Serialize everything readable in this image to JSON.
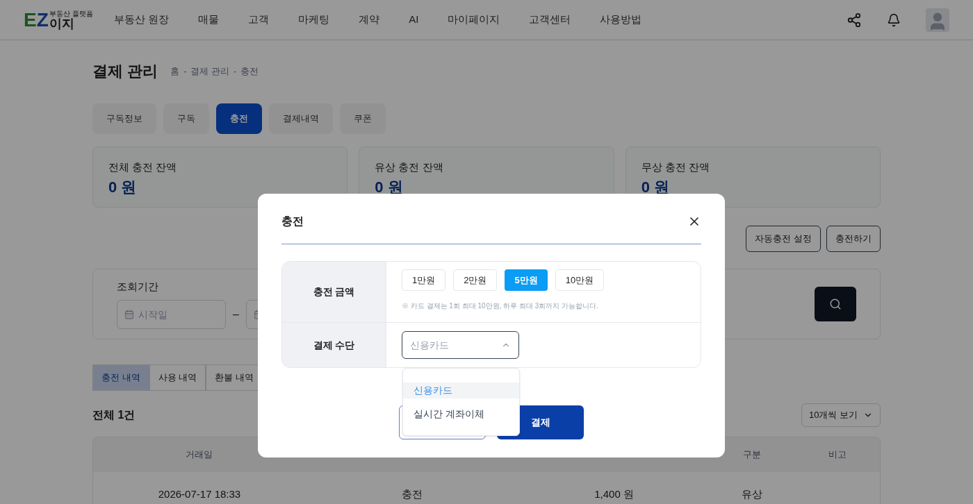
{
  "logo": {
    "mark_left": "E",
    "mark_right": "Z",
    "word": "이지",
    "tagline": "부동산 플랫폼"
  },
  "nav": [
    "부동산 원장",
    "매물",
    "고객",
    "마케팅",
    "계약",
    "AI",
    "마이페이지",
    "고객센터",
    "사용방법"
  ],
  "page": {
    "title": "결제 관리",
    "breadcrumb": [
      "홈",
      "결제 관리",
      "충전"
    ],
    "breadcrumb_separator": "-"
  },
  "tabs": [
    {
      "label": "구독정보",
      "selected": false
    },
    {
      "label": "구독",
      "selected": false
    },
    {
      "label": "충전",
      "selected": true
    },
    {
      "label": "결제내역",
      "selected": false
    },
    {
      "label": "쿠폰",
      "selected": false
    }
  ],
  "balances": [
    {
      "label": "전체 충전 잔액",
      "value": "0 원"
    },
    {
      "label": "유상 충전 잔액",
      "value": "0 원"
    },
    {
      "label": "무상 충전 잔액",
      "value": "0 원"
    }
  ],
  "actions": [
    "자동충전 설정",
    "충전하기"
  ],
  "filter": {
    "label": "조회기간",
    "start_placeholder": "시작일",
    "separator": "–"
  },
  "history_tabs": [
    {
      "label": "충전 내역",
      "selected": true
    },
    {
      "label": "사용 내역",
      "selected": false
    },
    {
      "label": "환불 내역",
      "selected": false
    }
  ],
  "total": "전체 1건",
  "page_size": "10개씩 보기",
  "table": {
    "columns_left": [
      "거래일"
    ],
    "columns_right": [
      "구분",
      "비고"
    ],
    "rows": [
      [
        "2026-07-17 18:33",
        "충전",
        "1,400 원",
        "유상",
        ""
      ]
    ]
  },
  "modal": {
    "title": "충전",
    "amount_label": "충전 금액",
    "amounts": [
      {
        "label": "1만원",
        "selected": false
      },
      {
        "label": "2만원",
        "selected": false
      },
      {
        "label": "5만원",
        "selected": true
      },
      {
        "label": "10만원",
        "selected": false
      }
    ],
    "note": "※ 카드 결제는 1회 최대 10만원, 하루 최대 3회까지 가능합니다.",
    "method_label": "결제 수단",
    "method_value": "신용카드",
    "options": [
      {
        "label": "신용카드",
        "selected": true
      },
      {
        "label": "실시간 계좌이체",
        "selected": false
      }
    ],
    "pay_button": "결제"
  }
}
